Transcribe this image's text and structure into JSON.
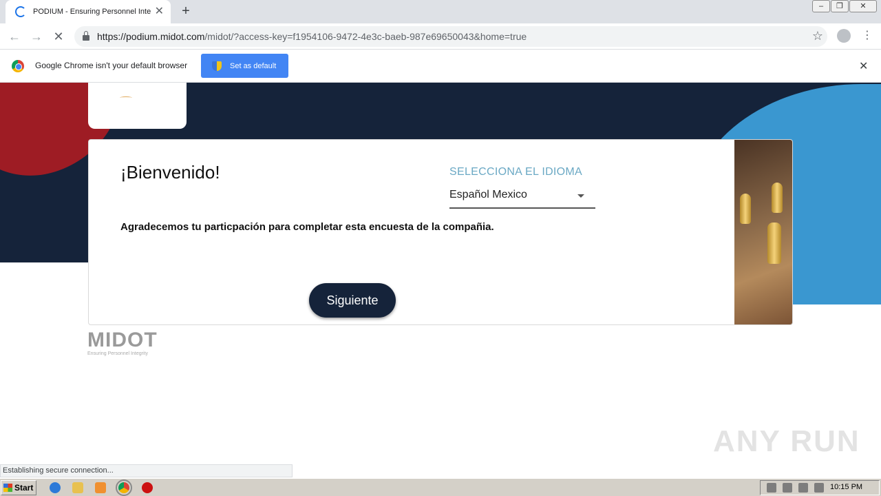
{
  "browser": {
    "tab_title": "PODIUM - Ensuring Personnel Integr",
    "url_host": "https://podium.midot.com",
    "url_path": "/midot/?access-key=f1954106-9472-4e3c-baeb-987e69650043&home=true"
  },
  "infobar": {
    "message": "Google Chrome isn't your default browser",
    "button_label": "Set as default"
  },
  "page": {
    "welcome": "¡Bienvenido!",
    "language_label": "SELECCIONA EL IDIOMA",
    "language_value": "Español Mexico",
    "description": "Agradecemos tu particpación para completar esta encuesta de la compañia.",
    "next_button": "Siguiente",
    "logo_word": "MIDOT",
    "logo_tagline": "Ensuring Personnel Integrity",
    "watermark": "ANY RUN"
  },
  "status_text": "Establishing secure connection...",
  "taskbar": {
    "start_label": "Start",
    "clock": "10:15 PM"
  },
  "colors": {
    "navy": "#15233a",
    "red": "#9e1c24",
    "blue": "#3a97d0",
    "chrome_blue": "#4285f4"
  }
}
